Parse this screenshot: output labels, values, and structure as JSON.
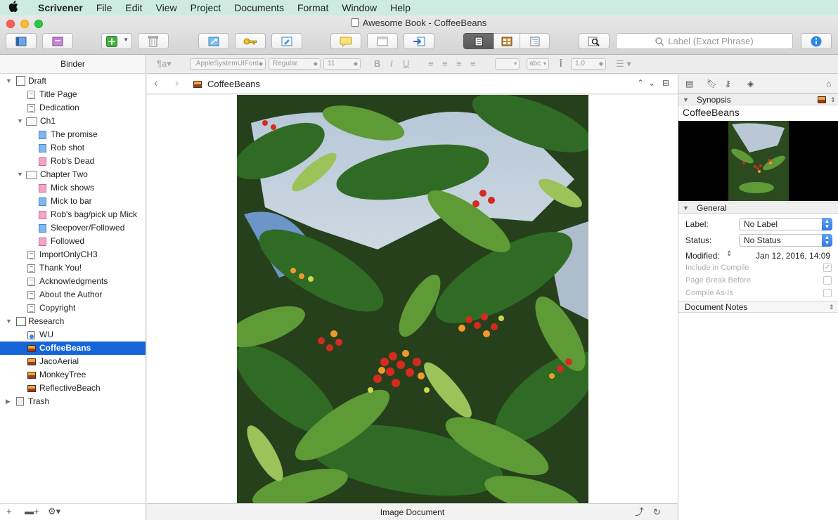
{
  "menubar": {
    "app_name": "Scrivener",
    "menus": [
      "File",
      "Edit",
      "View",
      "Project",
      "Documents",
      "Format",
      "Window",
      "Help"
    ]
  },
  "window": {
    "title": "Awesome Book - CoffeeBeans"
  },
  "toolbar": {
    "search_placeholder": "Label (Exact Phrase)"
  },
  "binder": {
    "header": "Binder",
    "items": [
      {
        "label": "Draft",
        "icon": "draft-icon",
        "level": 0,
        "disclosure": "open"
      },
      {
        "label": "Title Page",
        "icon": "text-doc-icon",
        "level": 1
      },
      {
        "label": "Dedication",
        "icon": "text-doc-icon",
        "level": 1
      },
      {
        "label": "Ch1",
        "icon": "folder-icon",
        "level": 1,
        "disclosure": "open"
      },
      {
        "label": "The promise",
        "icon": "blue-doc-icon",
        "level": 2
      },
      {
        "label": "Rob shot",
        "icon": "blue-doc-icon",
        "level": 2
      },
      {
        "label": "Rob's Dead",
        "icon": "pink-doc-icon",
        "level": 2
      },
      {
        "label": "Chapter Two",
        "icon": "folder-icon",
        "level": 1,
        "disclosure": "open"
      },
      {
        "label": "Mick shows",
        "icon": "pink-doc-icon",
        "level": 2
      },
      {
        "label": "Mick to bar",
        "icon": "blue-doc-icon",
        "level": 2
      },
      {
        "label": "Rob's bag/pick up Mick",
        "icon": "pink-doc-icon",
        "level": 2
      },
      {
        "label": "Sleepover/Followed",
        "icon": "blue-doc-icon",
        "level": 2
      },
      {
        "label": "Followed",
        "icon": "pink-doc-icon",
        "level": 2
      },
      {
        "label": "ImportOnlyCH3",
        "icon": "text-doc-icon",
        "level": 1
      },
      {
        "label": "Thank You!",
        "icon": "text-doc-icon",
        "level": 1
      },
      {
        "label": "Acknowledgments",
        "icon": "text-doc-icon",
        "level": 1
      },
      {
        "label": "About the Author",
        "icon": "text-doc-icon",
        "level": 1
      },
      {
        "label": "Copyright",
        "icon": "text-doc-icon",
        "level": 1
      },
      {
        "label": "Research",
        "icon": "research-icon",
        "level": 0,
        "disclosure": "open"
      },
      {
        "label": "WU",
        "icon": "webpage-icon",
        "level": 1
      },
      {
        "label": "CoffeeBeans",
        "icon": "image-doc-icon",
        "level": 1,
        "selected": true
      },
      {
        "label": "JacoAerial",
        "icon": "image-doc-icon",
        "level": 1
      },
      {
        "label": "MonkeyTree",
        "icon": "image-doc-icon",
        "level": 1
      },
      {
        "label": "ReflectiveBeach",
        "icon": "image-doc-icon",
        "level": 1
      },
      {
        "label": "Trash",
        "icon": "trash-icon",
        "level": 0,
        "disclosure": "closed"
      }
    ]
  },
  "format_bar": {
    "font_name": ".AppleSystemUIFont",
    "font_style": "Regular",
    "font_size": "11",
    "bold": "B",
    "italic": "I",
    "underline": "U",
    "highlight_label": "abc",
    "line_spacing": "1.0"
  },
  "editor": {
    "doc_title": "CoffeeBeans",
    "footer_label": "Image Document"
  },
  "inspector": {
    "synopsis_header": "Synopsis",
    "synopsis_title": "CoffeeBeans",
    "general_header": "General",
    "label_caption": "Label:",
    "label_value": "No Label",
    "status_caption": "Status:",
    "status_value": "No Status",
    "modified_caption": "Modified:",
    "modified_value": "Jan 12, 2016, 14:09",
    "include_in_compile": "Include in Compile",
    "page_break_before": "Page Break Before",
    "compile_as_is": "Compile As-Is",
    "document_notes": "Document Notes"
  },
  "colors": {
    "menubar_bg": "#cdebe0",
    "selection": "#1565d8",
    "accent_blue": "#2f77e3"
  }
}
